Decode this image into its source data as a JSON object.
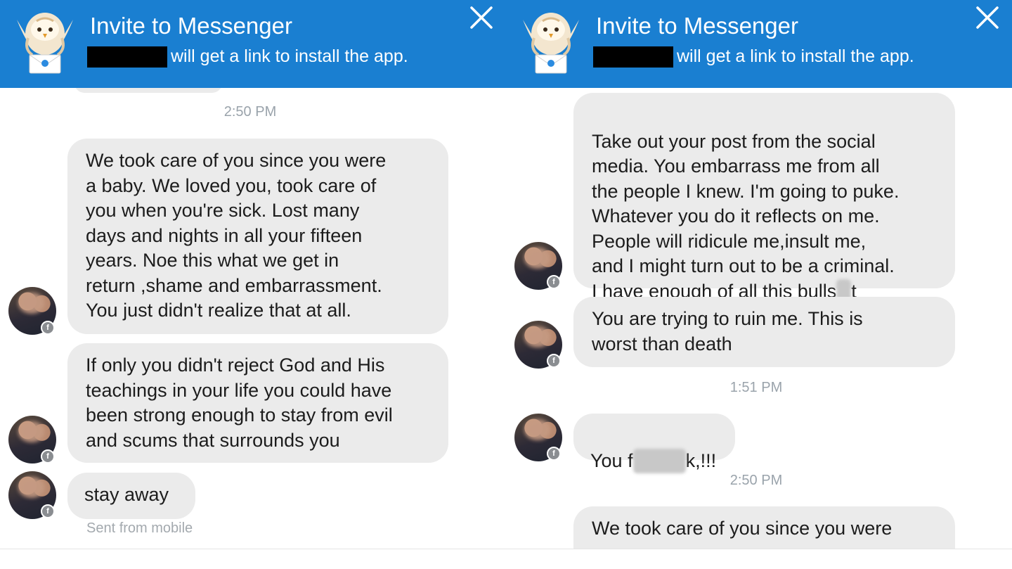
{
  "header": {
    "title": "Invite to Messenger",
    "subtitle": "will get a link to install the app.",
    "close_icon": "close-icon",
    "mascot_icon": "owl-mascot-icon"
  },
  "left": {
    "timestamp": "2:50 PM",
    "messages": [
      "We took care of you since you were\na baby. We loved you, took care of\nyou when you're sick. Lost many\ndays and nights in all your fifteen\nyears. Noe this what we get in\nreturn ,shame and embarrassment.\nYou just didn't realize that at all.",
      "If only you didn't reject God and His\nteachings in your life you could have\nbeen strong enough to stay from evil\nand scums that surrounds you",
      "stay away"
    ],
    "sent_from": "Sent from mobile"
  },
  "right": {
    "messages": [
      "Take out your post from the social\nmedia. You embarrass me from all\nthe people I knew. I'm going to puke.\nWhatever you do it reflects on me.\nPeople will ridicule me,insult me,\nand I might turn out to be a criminal.",
      "You are trying to ruin me. This is\nworst than death",
      "We took care of you since you were"
    ],
    "message1_last_line_start": "I have enough of all this bulls",
    "message1_last_line_end": "t",
    "timestamp_1": "1:51 PM",
    "short_message_start": "You f",
    "short_message_end": "k,!!!",
    "timestamp_2": "2:50 PM"
  },
  "colors": {
    "header_blue": "#1a7fd1",
    "bubble_gray": "#ebebeb",
    "timestamp_gray": "#9aa3ab"
  }
}
